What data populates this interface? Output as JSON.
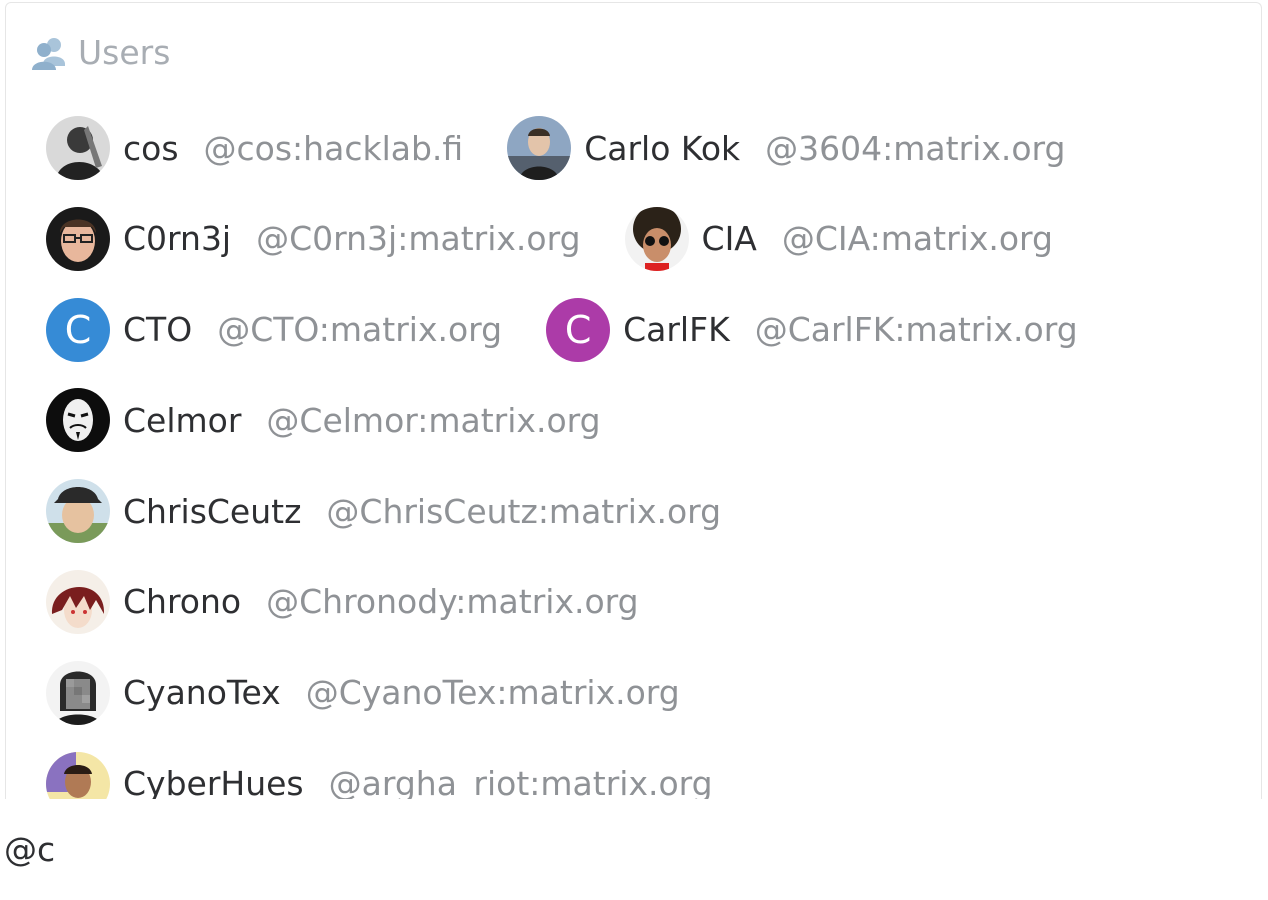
{
  "autocomplete": {
    "header": {
      "title": "Users",
      "icon": "users-icon"
    },
    "users": [
      {
        "name": "cos",
        "id": "@cos:hacklab.fi",
        "avatar": "photo",
        "tone": "#3a3a3a"
      },
      {
        "name": "Carlo Kok",
        "id": "@3604:matrix.org",
        "avatar": "photo",
        "tone": "#7a8fa8"
      },
      {
        "name": "C0rn3j",
        "id": "@C0rn3j:matrix.org",
        "avatar": "photo",
        "tone": "#4a3a30"
      },
      {
        "name": "CIA",
        "id": "@CIA:matrix.org",
        "avatar": "photo",
        "tone": "#2b2218"
      },
      {
        "name": "CTO",
        "id": "@CTO:matrix.org",
        "avatar": "letter",
        "letter": "C",
        "color": "#368bd6"
      },
      {
        "name": "CarlFK",
        "id": "@CarlFK:matrix.org",
        "avatar": "letter",
        "letter": "C",
        "color": "#ac3ba8"
      },
      {
        "name": "Celmor",
        "id": "@Celmor:matrix.org",
        "avatar": "photo",
        "tone": "#111111"
      },
      {
        "name": "ChrisCeutz",
        "id": "@ChrisCeutz:matrix.org",
        "avatar": "photo",
        "tone": "#c9b79a"
      },
      {
        "name": "Chrono",
        "id": "@Chronody:matrix.org",
        "avatar": "photo",
        "tone": "#7a2020"
      },
      {
        "name": "CyanoTex",
        "id": "@CyanoTex:matrix.org",
        "avatar": "photo",
        "tone": "#6b6b6b"
      },
      {
        "name": "CyberHues",
        "id": "@argha_riot:matrix.org",
        "avatar": "photo",
        "tone": "#6f5a9e"
      }
    ]
  },
  "composer": {
    "value": "@c"
  }
}
